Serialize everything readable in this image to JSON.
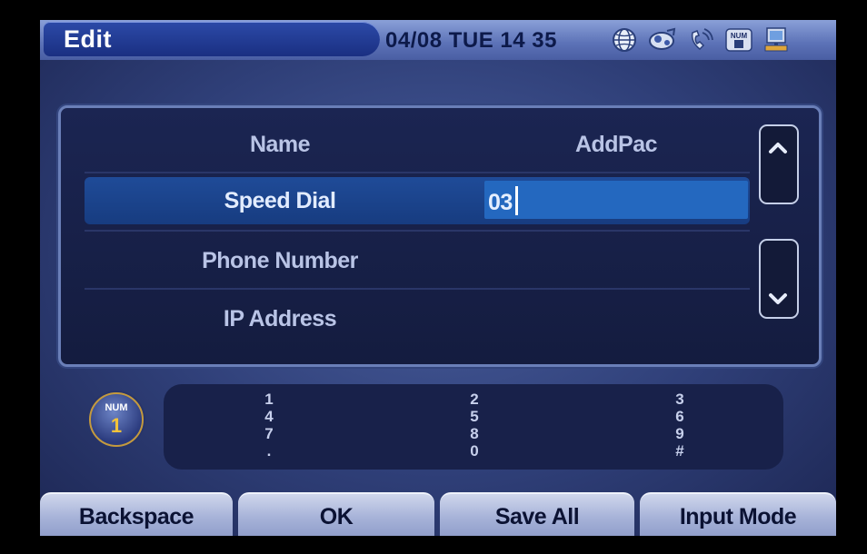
{
  "header": {
    "title": "Edit",
    "datetime": "04/08 TUE 14 35",
    "status_icons": [
      "globe-icon",
      "network-icon",
      "phone-icon",
      "num-keypad-icon",
      "pc-icon"
    ]
  },
  "list": {
    "rows": [
      {
        "label": "Name",
        "value": "AddPac"
      },
      {
        "label": "Speed Dial",
        "value": "03",
        "selected": true
      },
      {
        "label": "Phone Number",
        "value": ""
      },
      {
        "label": "IP Address",
        "value": ""
      }
    ]
  },
  "scroll": {
    "up_icon": "chevron-up-icon",
    "down_icon": "chevron-down-icon"
  },
  "input_mode_badge": {
    "top": "NUM",
    "bottom": "1"
  },
  "keypad": {
    "columns": [
      [
        "1",
        "4",
        "7",
        "."
      ],
      [
        "2",
        "5",
        "8",
        "0"
      ],
      [
        "3",
        "6",
        "9",
        "#"
      ]
    ]
  },
  "softkeys": [
    "Backspace",
    "OK",
    "Save All",
    "Input Mode"
  ],
  "colors": {
    "selected_row": "#1f4b98",
    "edit_field": "#2468bf",
    "title_tab": "#1a2f82"
  }
}
